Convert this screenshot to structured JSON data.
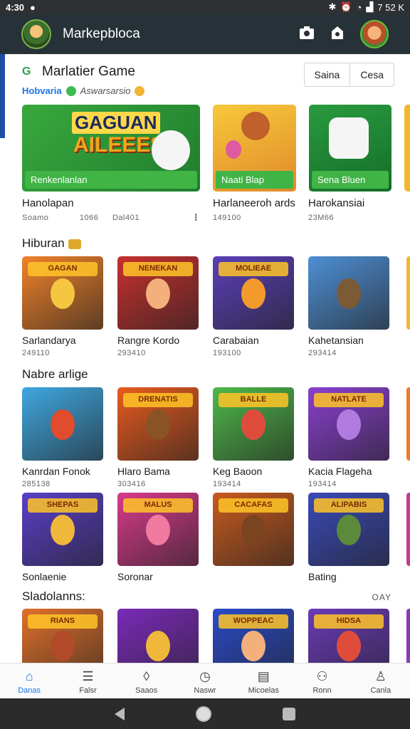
{
  "status": {
    "time": "4:30",
    "right_text": "7 52 K"
  },
  "app_bar": {
    "title": "Markepbloca",
    "icons": [
      "camera-icon",
      "shop-icon"
    ]
  },
  "featured": {
    "title": "Marlatier Game",
    "link": "Hobvaria",
    "meta": "Aswarsarsio",
    "buttons": [
      "Saina",
      "Cesa"
    ],
    "cards": [
      {
        "headline1": "GAGUAN",
        "headline2": "AILEEES",
        "label": "Renkenlanlan",
        "bg": "#2f9a3a"
      },
      {
        "label": "Naati Blap",
        "bg": "#f0b830"
      },
      {
        "label": "Sena Bluen",
        "bg": "#1f8a3a"
      }
    ],
    "items": [
      {
        "name": "Hanolapan",
        "meta1": "Soamo",
        "meta2": "1066",
        "meta3": "Dal401"
      },
      {
        "name": "Harlaneeroh ards",
        "meta1": "149100"
      },
      {
        "name": "Harokansiai",
        "meta1": "23M66"
      }
    ]
  },
  "sections": [
    {
      "title": "Hiburan",
      "rows": [
        [
          {
            "name": "Sarlandarya",
            "meta": "249110",
            "badge": "GAGAN",
            "bg": "#f0822a",
            "face": "#f5c640"
          },
          {
            "name": "Rangre Kordo",
            "meta": "293410",
            "badge": "NENEKAN",
            "bg": "#c6302e",
            "face": "#f3b07c"
          },
          {
            "name": "Carabaian",
            "meta": "193100",
            "badge": "MOLIEAE",
            "bg": "#5a3fb8",
            "face": "#f29a2c"
          },
          {
            "name": "Kahetansian",
            "meta": "293414",
            "badge": "",
            "bg": "#4e8fd4",
            "face": "#7b5a36"
          }
        ]
      ]
    },
    {
      "title": "Nabre arlige",
      "more": "",
      "rows": [
        [
          {
            "name": "Kanrdan Fonok",
            "meta": "285138",
            "badge": "",
            "bg": "#3fa7e0",
            "face": "#e04c2c"
          },
          {
            "name": "Hlaro Bama",
            "meta": "303416",
            "badge": "DRENATIS",
            "bg": "#e85a1e",
            "face": "#8a5326"
          },
          {
            "name": "Keg Baoon",
            "meta": "193414",
            "badge": "BALLE",
            "bg": "#4fb84a",
            "face": "#e04c3c"
          },
          {
            "name": "Kacia Flageha",
            "meta": "193414",
            "badge": "NATLATE",
            "bg": "#8a3fd0",
            "face": "#b07be0"
          }
        ],
        [
          {
            "name": "Sonlaenie",
            "meta": "",
            "badge": "SHEPAS",
            "bg": "#5a3fc8",
            "face": "#f0b83a"
          },
          {
            "name": "Soronar",
            "meta": "",
            "badge": "MALUS",
            "bg": "#d83a8a",
            "face": "#f07aa0"
          },
          {
            "name": "",
            "meta": "",
            "badge": "CACAFAS",
            "bg": "#c85a1e",
            "face": "#7a4420"
          },
          {
            "name": "Bating",
            "meta": "",
            "badge": "ALIPABIS",
            "bg": "#3a4ab8",
            "face": "#5a8a3a"
          }
        ]
      ]
    },
    {
      "title": "Sladolanns:",
      "more": "OAY",
      "rows": [
        [
          {
            "name": "",
            "meta": "",
            "badge": "RIANS",
            "bg": "#e0702a",
            "face": "#b04a28"
          },
          {
            "name": "",
            "meta": "",
            "badge": "",
            "bg": "#7a2ab8",
            "face": "#f0b83a"
          },
          {
            "name": "",
            "meta": "",
            "badge": "WOPPEAC",
            "bg": "#2a4ac8",
            "face": "#f3b07c"
          },
          {
            "name": "",
            "meta": "",
            "badge": "HIDSA",
            "bg": "#6a3ab8",
            "face": "#e04c3c"
          }
        ]
      ]
    }
  ],
  "bottom_nav": [
    {
      "label": "Danas",
      "icon": "home-icon"
    },
    {
      "label": "Falsr",
      "icon": "list-icon"
    },
    {
      "label": "Saaos",
      "icon": "drop-icon"
    },
    {
      "label": "Naswr",
      "icon": "clock-icon"
    },
    {
      "label": "Micoelas",
      "icon": "note-icon"
    },
    {
      "label": "Ronn",
      "icon": "people-icon"
    },
    {
      "label": "Canla",
      "icon": "person-icon"
    }
  ]
}
